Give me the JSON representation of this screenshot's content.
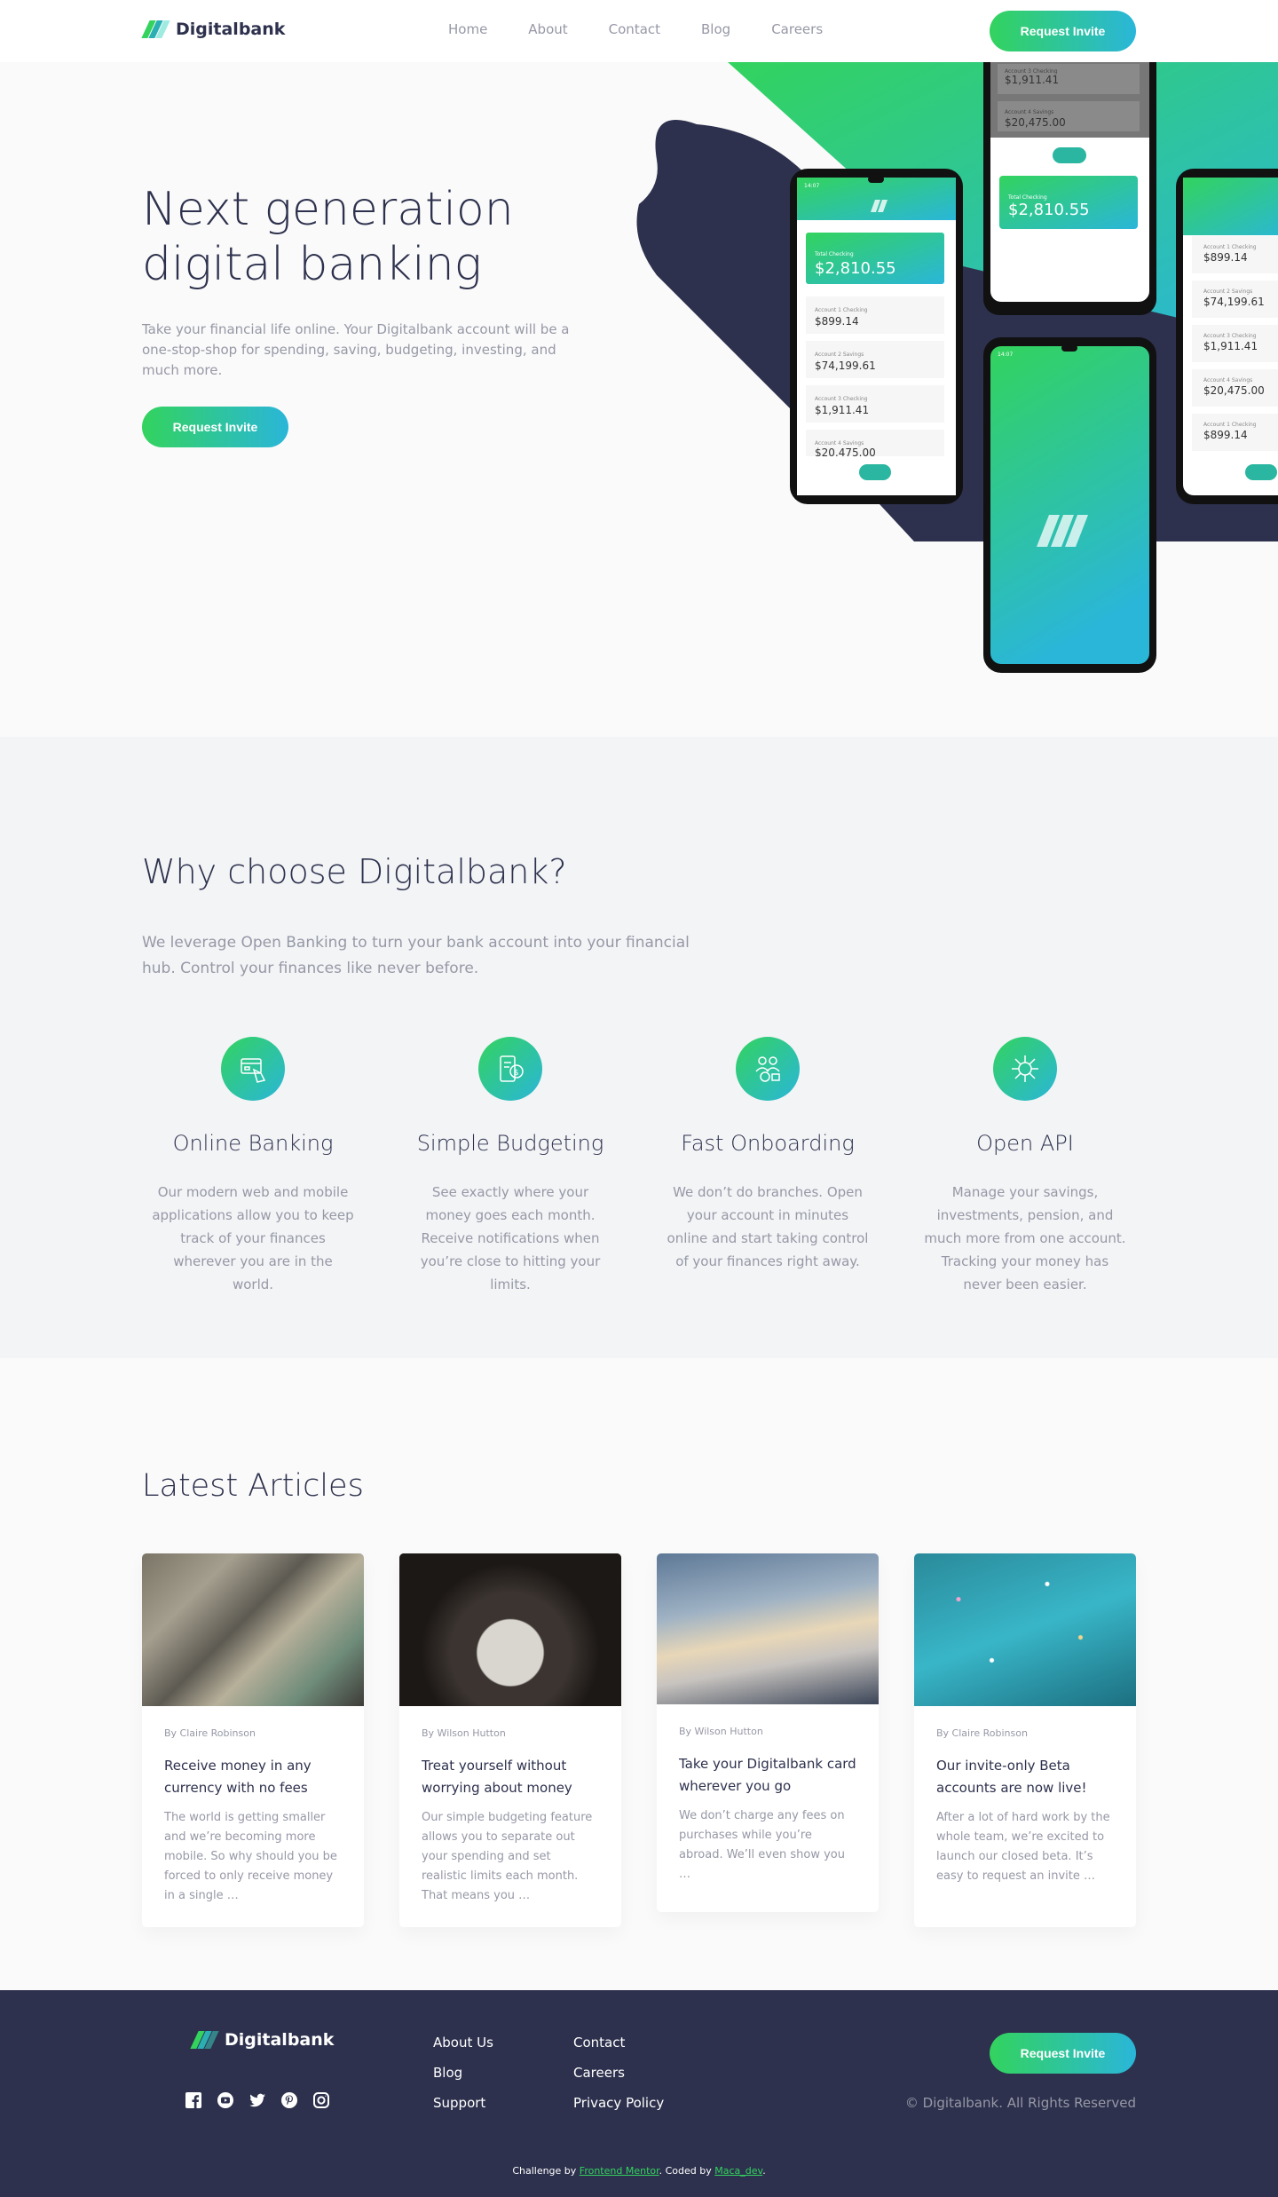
{
  "brand": {
    "name": "Digitalbank"
  },
  "nav": {
    "items": [
      "Home",
      "About",
      "Contact",
      "Blog",
      "Careers"
    ]
  },
  "cta": {
    "label": "Request Invite"
  },
  "hero": {
    "title": "Next generation digital banking",
    "text": "Take your financial life online. Your Digitalbank account will be a one-stop-shop for spending, saving, budgeting, investing, and much more.",
    "button": "Request Invite",
    "phone_left": {
      "time": "14:07",
      "total_label": "Total Checking",
      "total": "$2,810.55",
      "accounts": [
        {
          "label": "Account 1 Checking",
          "value": "$899.14"
        },
        {
          "label": "Account 2 Savings",
          "value": "$74,199.61"
        },
        {
          "label": "Account 3 Checking",
          "value": "$1,911.41"
        },
        {
          "label": "Account 4 Savings",
          "value": "$20,475.00"
        }
      ]
    },
    "phone_top": {
      "accounts": [
        {
          "label": "Account 3 Checking",
          "value": "$1,911.41"
        },
        {
          "label": "Account 4 Savings",
          "value": "$20,475.00"
        }
      ],
      "total_label": "Total Checking",
      "total": "$2,810.55"
    },
    "phone_right": {
      "accounts": [
        {
          "label": "Account 1 Checking",
          "value": "$899.14"
        },
        {
          "label": "Account 2 Savings",
          "value": "$74,199.61"
        },
        {
          "label": "Account 3 Checking",
          "value": "$1,911.41"
        },
        {
          "label": "Account 4 Savings",
          "value": "$20,475.00"
        },
        {
          "label": "Account 1 Checking",
          "value": "$899.14"
        }
      ]
    },
    "phone_splash": {
      "time": "14:07"
    }
  },
  "why": {
    "title": "Why choose Digitalbank?",
    "text": "We leverage Open Banking to turn your bank account into your financial hub. Control your finances like never before.",
    "features": [
      {
        "icon": "online-banking-icon",
        "title": "Online Banking",
        "text": "Our modern web and mobile applications allow you to keep track of your finances wherever you are in the world."
      },
      {
        "icon": "budgeting-icon",
        "title": "Simple Budgeting",
        "text": "See exactly where your money goes each month. Receive notifications when you’re close to hitting your limits."
      },
      {
        "icon": "onboarding-icon",
        "title": "Fast Onboarding",
        "text": "We don’t do branches. Open your account in minutes online and start taking control of your finances right away."
      },
      {
        "icon": "api-icon",
        "title": "Open API",
        "text": "Manage your savings, investments, pension, and much more from one account. Tracking your money has never been easier."
      }
    ]
  },
  "articles": {
    "title": "Latest Articles",
    "items": [
      {
        "author": "By Claire Robinson",
        "title": "Receive money in any currency with no fees",
        "text": "The world is getting smaller and we’re becoming more mobile. So why should you be forced to only receive money in a single …"
      },
      {
        "author": "By Wilson Hutton",
        "title": "Treat yourself without worrying about money",
        "text": "Our simple budgeting feature allows you to separate out your spending and set realistic limits each month. That means you …"
      },
      {
        "author": "By Wilson Hutton",
        "title": "Take your Digitalbank card wherever you go",
        "text": "We don’t charge any fees on purchases while you’re abroad. We’ll even show you …"
      },
      {
        "author": "By Claire Robinson",
        "title": "Our invite-only Beta accounts are now live!",
        "text": "After a lot of hard work by the whole team, we’re excited to launch our closed beta. It’s easy to request an invite …"
      }
    ]
  },
  "footer": {
    "links_col1": [
      "About Us",
      "Blog",
      "Support"
    ],
    "links_col2": [
      "Contact",
      "Careers",
      "Privacy Policy"
    ],
    "copyright": "© Digitalbank. All Rights Reserved",
    "attribution": {
      "prefix": "Challenge by ",
      "mentor": "Frontend Mentor",
      "middle": ". Coded by ",
      "author": "Maca_dev",
      "suffix": "."
    },
    "social": [
      "facebook-icon",
      "youtube-icon",
      "twitter-icon",
      "pinterest-icon",
      "instagram-icon"
    ]
  },
  "colors": {
    "dark": "#2d314d",
    "green": "#33d35e",
    "cyan": "#2ab6d9",
    "gray": "#9698a6"
  }
}
